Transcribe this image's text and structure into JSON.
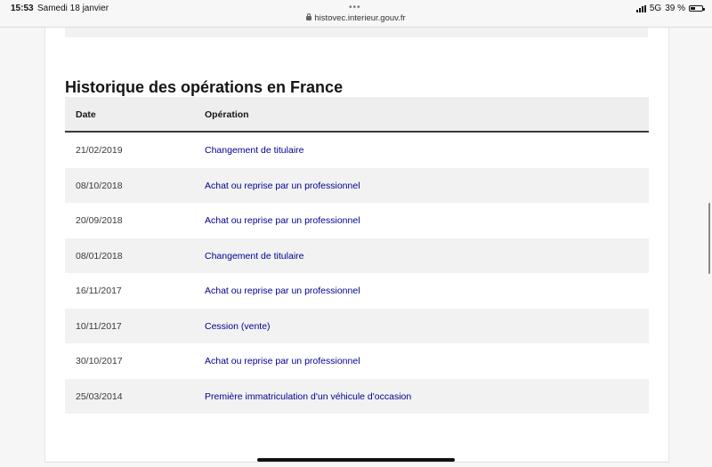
{
  "status_bar": {
    "time": "15:53",
    "date": "Samedi 18 janvier",
    "url": "histovec.interieur.gouv.fr",
    "network": "5G",
    "battery": "39 %",
    "battery_level": 0.39
  },
  "section": {
    "title": "Historique des opérations en France"
  },
  "table": {
    "headers": {
      "date": "Date",
      "operation": "Opération"
    },
    "rows": [
      {
        "date": "21/02/2019",
        "operation": "Changement de titulaire"
      },
      {
        "date": "08/10/2018",
        "operation": "Achat ou reprise par un professionnel"
      },
      {
        "date": "20/09/2018",
        "operation": "Achat ou reprise par un professionnel"
      },
      {
        "date": "08/01/2018",
        "operation": "Changement de titulaire"
      },
      {
        "date": "16/11/2017",
        "operation": "Achat ou reprise par un professionnel"
      },
      {
        "date": "10/11/2017",
        "operation": "Cession (vente)"
      },
      {
        "date": "30/10/2017",
        "operation": "Achat ou reprise par un professionnel"
      },
      {
        "date": "25/03/2014",
        "operation": "Première immatriculation d'un véhicule d'occasion"
      }
    ]
  },
  "colors": {
    "link": "#000091",
    "header_bg": "#eeeeee",
    "row_alt_bg": "#f2f2f2"
  }
}
